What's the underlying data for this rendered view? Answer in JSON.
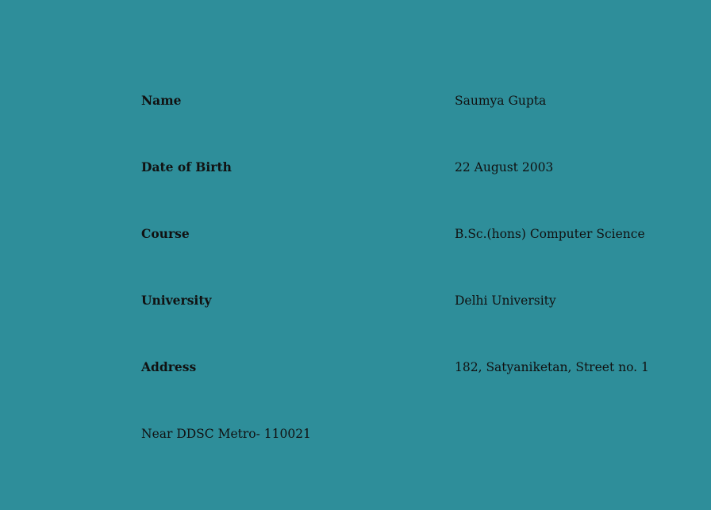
{
  "details": [
    {
      "label": "Name",
      "value": "Saumya Gupta"
    },
    {
      "label": "Date of Birth",
      "value": "22 August 2003"
    },
    {
      "label": "Course",
      "value": "B.Sc.(hons) Computer Science"
    },
    {
      "label": "University",
      "value": "Delhi University"
    },
    {
      "label": "Address",
      "value": "182, Satyaniketan, Street no. 1"
    }
  ],
  "address_line_2": "Near DDSC Metro- 110021",
  "colors": {
    "background": "#2e8e9a",
    "text": "#111111"
  }
}
